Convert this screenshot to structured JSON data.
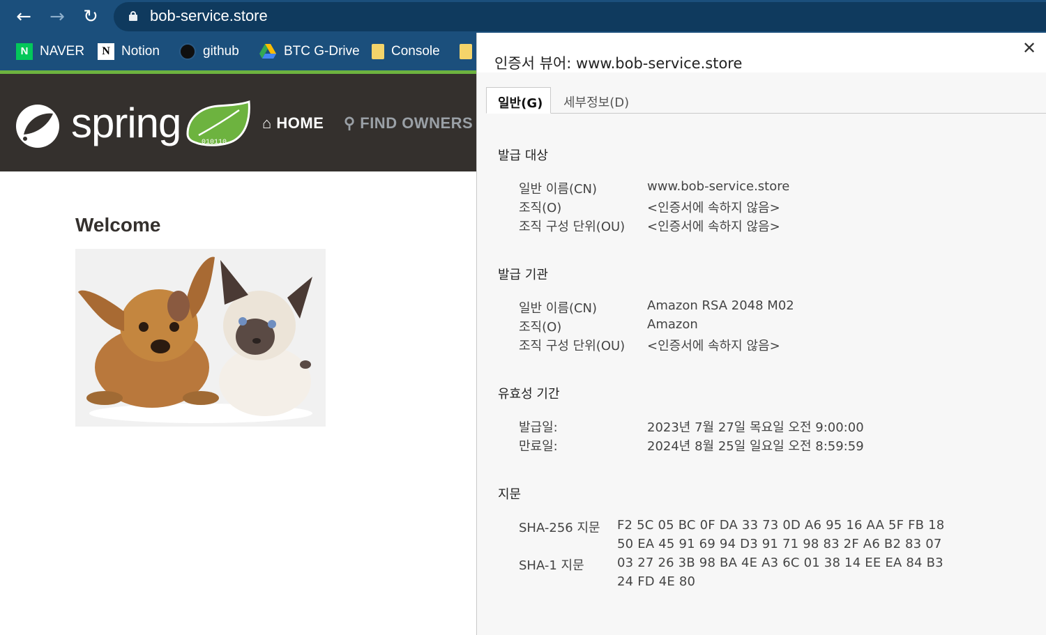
{
  "browser": {
    "url": "bob-service.store",
    "nav": {
      "back_icon": "←",
      "forward_icon": "→",
      "reload_icon": "↻"
    },
    "bookmarks": [
      {
        "label": "NAVER",
        "icon": "naver-icon",
        "glyph": "N"
      },
      {
        "label": "Notion",
        "icon": "notion-icon",
        "glyph": "N"
      },
      {
        "label": "github",
        "icon": "github-icon"
      },
      {
        "label": "BTC G-Drive",
        "icon": "google-drive-icon"
      },
      {
        "label": "Console",
        "icon": "folder-icon"
      },
      {
        "label": "",
        "icon": "folder-icon"
      }
    ]
  },
  "site": {
    "logo_word": "spring",
    "logo_leaf_text": "010110",
    "nav_home": "HOME",
    "nav_find_owners": "FIND OWNERS",
    "welcome": "Welcome",
    "colors": {
      "header": "#34302d",
      "accent": "#6db33f"
    }
  },
  "cert": {
    "title": "인증서 뷰어: www.bob-service.store",
    "close_icon": "✕",
    "tabs": [
      {
        "label": "일반(G)",
        "active": true
      },
      {
        "label": "세부정보(D)",
        "active": false
      }
    ],
    "subject": {
      "heading": "발급 대상",
      "fields": [
        {
          "label": "일반 이름(CN)",
          "value": "www.bob-service.store"
        },
        {
          "label": "조직(O)",
          "value": "<인증서에 속하지 않음>"
        },
        {
          "label": "조직 구성 단위(OU)",
          "value": "<인증서에 속하지 않음>"
        }
      ]
    },
    "issuer": {
      "heading": "발급 기관",
      "fields": [
        {
          "label": "일반 이름(CN)",
          "value": "Amazon RSA 2048 M02"
        },
        {
          "label": "조직(O)",
          "value": "Amazon"
        },
        {
          "label": "조직 구성 단위(OU)",
          "value": "<인증서에 속하지 않음>"
        }
      ]
    },
    "validity": {
      "heading": "유효성 기간",
      "fields": [
        {
          "label": "발급일:",
          "value": "2023년 7월 27일 목요일 오전 9:00:00"
        },
        {
          "label": "만료일:",
          "value": "2024년 8월 25일 일요일 오전 8:59:59"
        }
      ]
    },
    "fingerprints": {
      "heading": "지문",
      "sha256_label": "SHA-256 지문",
      "sha256_line1": "F2 5C 05 BC 0F DA 33 73 0D A6 95 16 AA 5F FB 18",
      "sha256_line2": "50 EA 45 91 69 94 D3 91 71 98 83 2F A6 B2 83 07",
      "sha1_label": "SHA-1 지문",
      "sha1_line1": "03 27 26 3B 98 BA 4E A3 6C 01 38 14 EE EA 84 B3",
      "sha1_line2": "24 FD 4E 80"
    }
  }
}
